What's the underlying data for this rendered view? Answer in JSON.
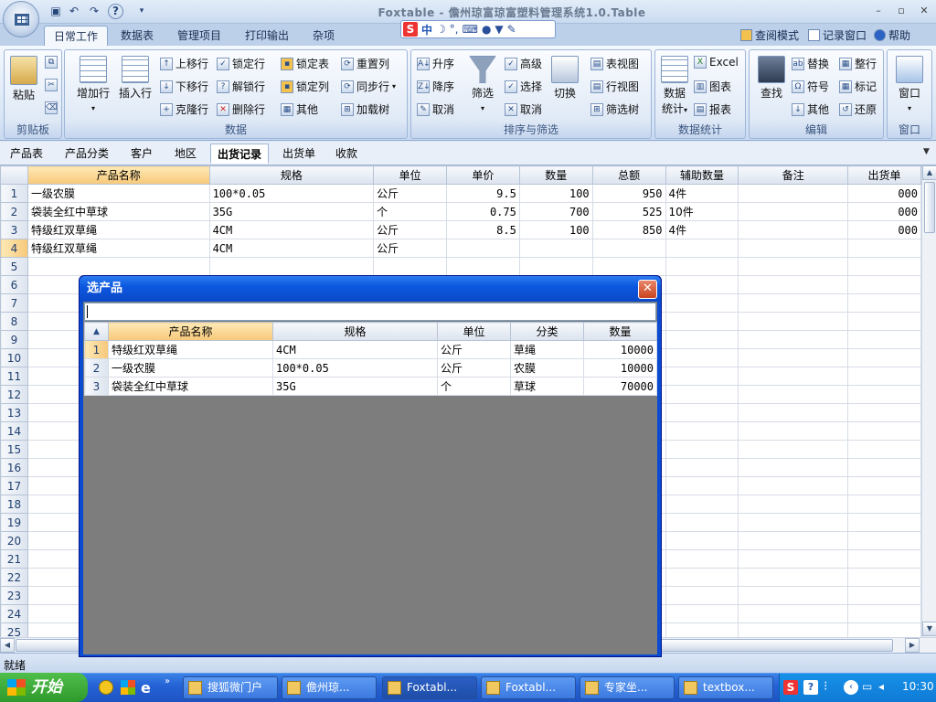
{
  "window": {
    "title": "Foxtable - 儋州琼富琼富塑料管理系统1.0.Table",
    "controls": [
      "–",
      "▫",
      "✕"
    ]
  },
  "quick_access": [
    "save-icon",
    "undo-icon",
    "redo-icon",
    "help-icon"
  ],
  "ime": {
    "logo": "S",
    "lang": "中",
    "icons": [
      "moon-icon",
      "punct-icon",
      "keyboard-icon",
      "user-icon",
      "shirt-icon",
      "wrench-icon"
    ]
  },
  "ribbon_tabs": [
    "日常工作",
    "数据表",
    "管理项目",
    "打印输出",
    "杂项"
  ],
  "active_ribbon_tab": "日常工作",
  "top_right": {
    "view_mode": "查阅模式",
    "record_window": "记录窗口",
    "help": "帮助"
  },
  "groups": {
    "clipboard": {
      "label": "剪贴板",
      "paste": "粘贴"
    },
    "data": {
      "label": "数据",
      "add_row": "增加行",
      "insert_row": "插入行",
      "move_up": "上移行",
      "move_down": "下移行",
      "clone_row": "克隆行",
      "lock_row": "锁定行",
      "unlock_row": "解锁行",
      "delete_row": "删除行",
      "lock_table": "锁定表",
      "lock_column": "锁定列",
      "other": "其他",
      "reset_column": "重置列",
      "sync_row": "同步行",
      "load_tree": "加载树"
    },
    "sort_filter": {
      "label": "排序与筛选",
      "asc": "升序",
      "desc": "降序",
      "cancel": "取消",
      "filter": "筛选",
      "advanced": "高级",
      "select": "选择",
      "cancel2": "取消",
      "switch": "切换",
      "table_view": "表视图",
      "row_view": "行视图",
      "filter_tree": "筛选树"
    },
    "stats": {
      "label": "数据统计",
      "data_stats": "数据",
      "stats": "统计",
      "excel": "Excel",
      "chart": "图表",
      "report": "报表"
    },
    "edit": {
      "label": "编辑",
      "find": "查找",
      "replace": "替换",
      "symbol": "符号",
      "other": "其他",
      "tidy": "整行",
      "mark": "标记",
      "restore": "还原"
    },
    "window": {
      "label": "窗口",
      "window": "窗口"
    }
  },
  "sheet_tabs": [
    "产品表",
    "产品分类",
    "客户",
    "地区",
    "出货记录",
    "出货单",
    "收款"
  ],
  "active_sheet": "出货记录",
  "main_table": {
    "columns": [
      "产品名称",
      "规格",
      "单位",
      "单价",
      "数量",
      "总额",
      "辅助数量",
      "备注",
      "出货单"
    ],
    "rows": [
      {
        "n": "1",
        "c": [
          "一级农膜",
          "100*0.05",
          "公斤",
          "9.5",
          "100",
          "950",
          "4件",
          "",
          "000"
        ]
      },
      {
        "n": "2",
        "c": [
          "袋装全红中草球",
          "35G",
          "个",
          "0.75",
          "700",
          "525",
          "10件",
          "",
          "000"
        ]
      },
      {
        "n": "3",
        "c": [
          "特级红双草绳",
          "4CM",
          "公斤",
          "8.5",
          "100",
          "850",
          "4件",
          "",
          "000"
        ]
      },
      {
        "n": "4",
        "c": [
          "特级红双草绳",
          "4CM",
          "公斤",
          "",
          "",
          "",
          "",
          "",
          ""
        ]
      }
    ],
    "empty_row_numbers": [
      "5",
      "6",
      "7",
      "8",
      "9",
      "10",
      "11",
      "12",
      "13",
      "14",
      "15",
      "16",
      "17",
      "18",
      "19",
      "20",
      "21",
      "22",
      "23",
      "24",
      "25"
    ]
  },
  "dialog": {
    "title": "选产品",
    "close": "✕",
    "search_value": "",
    "columns": [
      "产品名称",
      "规格",
      "单位",
      "分类",
      "数量"
    ],
    "rows": [
      {
        "n": "1",
        "c": [
          "特级红双草绳",
          "4CM",
          "公斤",
          "草绳",
          "10000"
        ]
      },
      {
        "n": "2",
        "c": [
          "一级农膜",
          "100*0.05",
          "公斤",
          "农膜",
          "10000"
        ]
      },
      {
        "n": "3",
        "c": [
          "袋装全红中草球",
          "35G",
          "个",
          "草球",
          "70000"
        ]
      }
    ]
  },
  "status": "就绪",
  "taskbar": {
    "start": "开始",
    "tasks": [
      "搜狐微门户",
      "儋州琼...",
      "Foxtabl...",
      "Foxtabl...",
      "专家坐...",
      "textbox..."
    ],
    "active_task": 2,
    "clock": "10:30"
  }
}
